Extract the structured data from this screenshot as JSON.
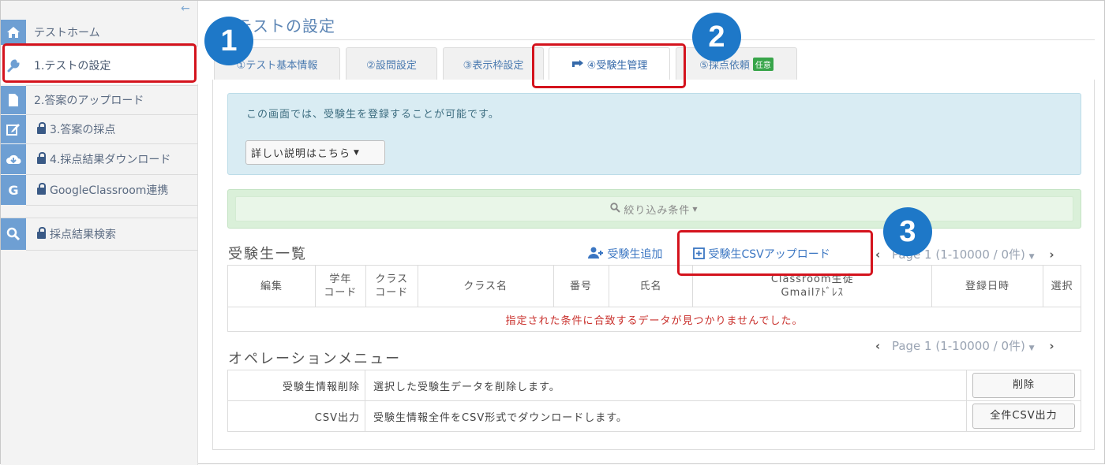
{
  "sidebar": {
    "collapse_icon": "arrow-left-icon",
    "items": [
      {
        "label": "テストホーム",
        "icon": "home-icon",
        "locked": false
      },
      {
        "label": "1.テストの設定",
        "icon": "wrench-icon",
        "locked": false
      },
      {
        "label": "2.答案のアップロード",
        "icon": "file-icon",
        "locked": false
      },
      {
        "label": "3.答案の採点",
        "icon": "edit-icon",
        "locked": true
      },
      {
        "label": "4.採点結果ダウンロード",
        "icon": "cloud-download-icon",
        "locked": true
      },
      {
        "label": "GoogleClassroom連携",
        "icon": "google-icon",
        "locked": true,
        "icon_glyph": "G"
      },
      {
        "label": "採点結果検索",
        "icon": "search-icon",
        "locked": true
      }
    ]
  },
  "header": {
    "title": "テストの設定"
  },
  "tabs": [
    {
      "label": "①テスト基本情報"
    },
    {
      "label": "②設問設定"
    },
    {
      "label": "③表示枠設定"
    },
    {
      "label": "④受験生管理",
      "active": true,
      "icon": "hand-pointer-icon"
    },
    {
      "label": "⑤採点依頼",
      "badge": "任意"
    }
  ],
  "info": {
    "text": "この画面では、受験生を登録することが可能です。",
    "detail_button": "詳しい説明はこちら"
  },
  "filter": {
    "label": "絞り込み条件"
  },
  "student_list": {
    "heading": "受験生一覧",
    "add_link": "受験生追加",
    "csv_upload_link": "受験生CSVアップロード",
    "pager": "Page 1 (1-10000 / 0件)",
    "columns": [
      "編集",
      "学年\nコード",
      "クラス\nコード",
      "クラス名",
      "番号",
      "氏名",
      "Classroom生徒\nGmailｱﾄﾞﾚｽ",
      "登録日時",
      "選択"
    ],
    "empty_message": "指定された条件に合致するデータが見つかりませんでした。"
  },
  "operations": {
    "heading": "オペレーションメニュー",
    "pager": "Page 1 (1-10000 / 0件)",
    "rows": [
      {
        "name": "受験生情報削除",
        "description": "選択した受験生データを削除します。",
        "button": "削除"
      },
      {
        "name": "CSV出力",
        "description": "受験生情報全件をCSV形式でダウンロードします。",
        "button": "全件CSV出力"
      }
    ]
  },
  "callouts": [
    "1",
    "2",
    "3"
  ],
  "colors": {
    "accent": "#1e78c8",
    "highlight": "#d4131d",
    "sidebar_icon": "#6e9fd3",
    "info_bg": "#d9ecf3",
    "filter_bg": "#daf0d9",
    "error_text": "#c9302c",
    "badge": "#38a54a"
  }
}
